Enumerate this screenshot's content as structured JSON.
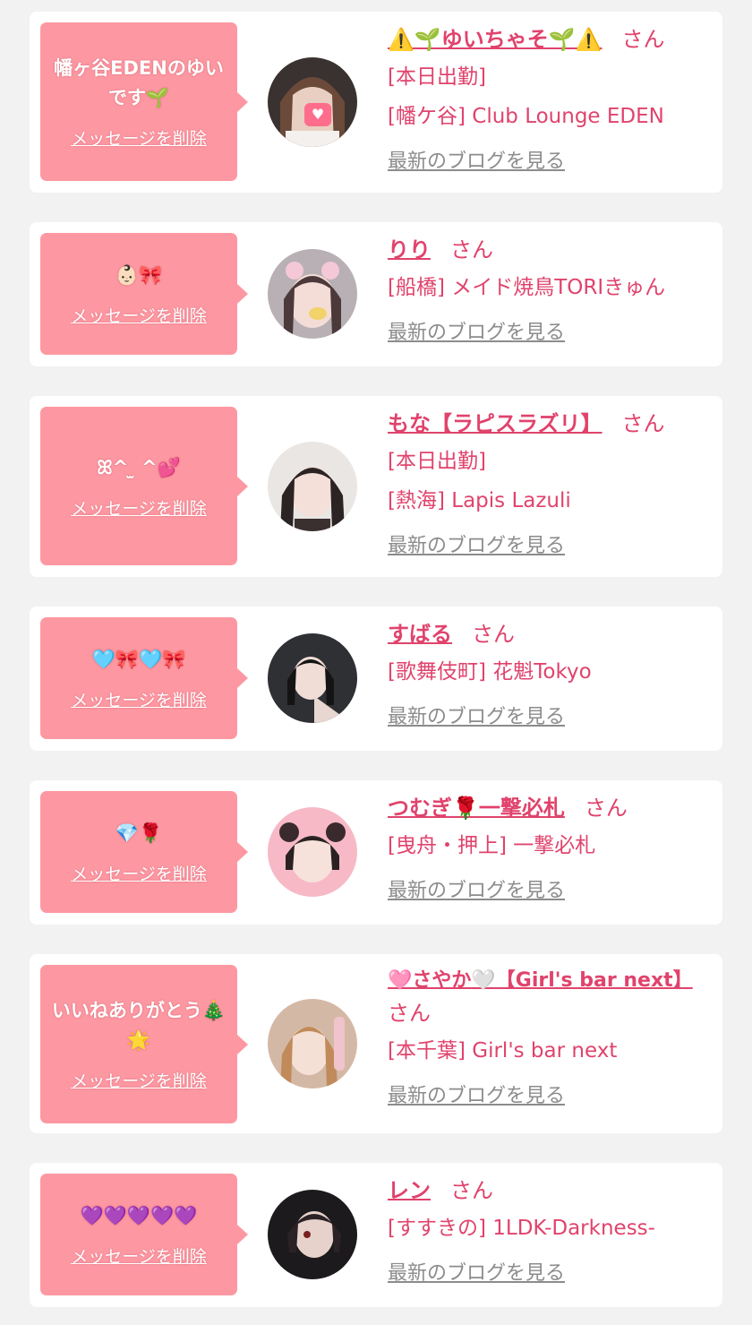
{
  "cards": [
    {
      "message": "幡ヶ谷EDENのゆいです🌱",
      "delete_label": "メッセージを削除",
      "name": "⚠️🌱ゆいちゃそ🌱⚠️",
      "honorific": "さん",
      "status": "[本日出勤]",
      "shop": "[幡ケ谷] Club Lounge EDEN",
      "blog_label": "最新のブログを見る"
    },
    {
      "message": "👶🏻🎀",
      "delete_label": "メッセージを削除",
      "name": "りり",
      "honorific": "さん",
      "status": "",
      "shop": "[船橋] メイド焼鳥TORIきゅん",
      "blog_label": "最新のブログを見る"
    },
    {
      "message": "ꕤ^ ̫ ^💕",
      "delete_label": "メッセージを削除",
      "name": "もな【ラピスラズリ】",
      "honorific": "さん",
      "status": "[本日出勤]",
      "shop": "[熱海] Lapis Lazuli",
      "blog_label": "最新のブログを見る"
    },
    {
      "message": "🩵🎀🩵🎀",
      "delete_label": "メッセージを削除",
      "name": "すばる",
      "honorific": "さん",
      "status": "",
      "shop": "[歌舞伎町] 花魁Tokyo",
      "blog_label": "最新のブログを見る"
    },
    {
      "message": "💎🌹",
      "delete_label": "メッセージを削除",
      "name": "つむぎ🌹一撃必札",
      "honorific": "さん",
      "status": "",
      "shop": "[曳舟・押上] 一撃必札",
      "blog_label": "最新のブログを見る"
    },
    {
      "message": "いいねありがとう🎄🌟",
      "delete_label": "メッセージを削除",
      "name": "🩷さやか🤍【Girl's bar next】",
      "honorific": "さん",
      "status": "",
      "shop": "[本千葉] Girl's bar next",
      "blog_label": "最新のブログを見る"
    },
    {
      "message": "💜💜💜💜💜",
      "delete_label": "メッセージを削除",
      "name": "レン",
      "honorific": "さん",
      "status": "",
      "shop": "[すすきの] 1LDK-Darkness-",
      "blog_label": "最新のブログを見る"
    }
  ],
  "colors": {
    "background": "#f2f2f2",
    "card": "#ffffff",
    "bubble": "#fd98a2",
    "accent_text": "#e0436c",
    "link_gray": "#8c8c8c"
  }
}
